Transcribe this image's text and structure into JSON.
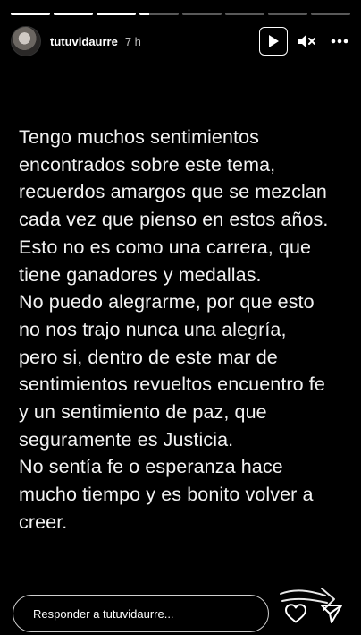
{
  "progress": {
    "segments": [
      1,
      1,
      1,
      0.25,
      0,
      0,
      0,
      0
    ]
  },
  "header": {
    "username": "tutuvidaurre",
    "time": "7 h"
  },
  "story": {
    "lines": [
      "Tengo muchos sentimientos",
      "encontrados sobre este tema,",
      "recuerdos amargos que se mezclan",
      "cada vez que pienso en estos años.",
      "Esto no es como una carrera, que",
      "tiene ganadores y medallas.",
      "No puedo alegrarme, por que esto",
      "no nos trajo nunca una alegría,",
      "pero si, dentro de este mar de",
      "sentimientos revueltos encuentro fe",
      "y un sentimiento de paz, que",
      "seguramente es Justicia.",
      "No sentía fe o esperanza hace",
      "mucho tiempo y es bonito volver a",
      "creer."
    ]
  },
  "footer": {
    "reply_placeholder": "Responder a tutuvidaurre..."
  },
  "icons": {
    "play": "play-icon",
    "mute": "mute-icon",
    "more": "more-icon",
    "heart": "heart-icon",
    "send": "send-icon"
  }
}
